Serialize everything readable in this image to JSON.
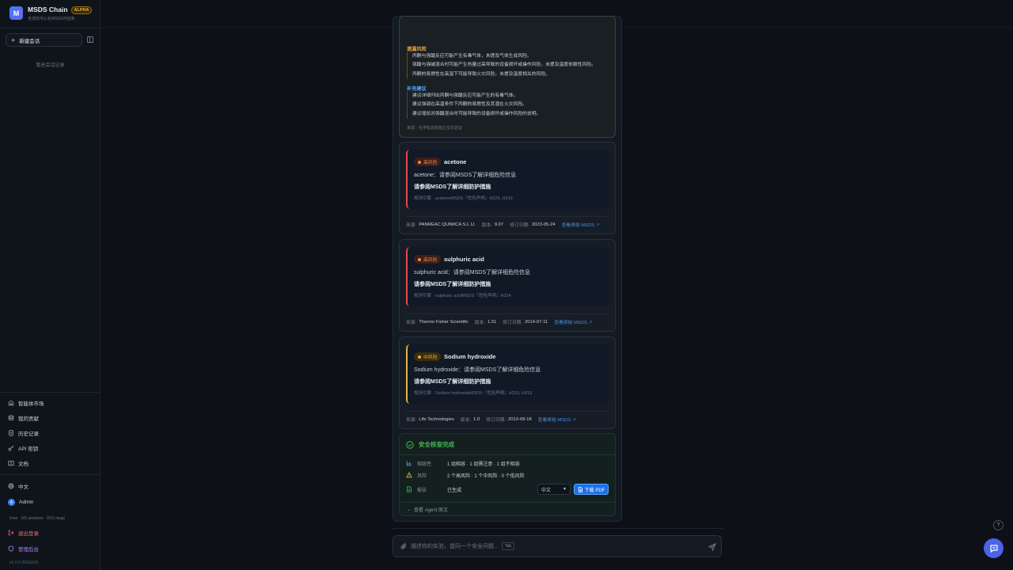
{
  "app": {
    "title": "MSDS Chain",
    "badge": "ALPHA",
    "subtitle": "全球去中心化MSDS可信库",
    "logo_letter": "M"
  },
  "sidebar": {
    "new_chat_label": "新建会话",
    "no_sessions": "暂无会话记录",
    "nav": [
      {
        "label": "智能体市场",
        "icon": "store-icon"
      },
      {
        "label": "我的贡献",
        "icon": "database-icon"
      },
      {
        "label": "历史记录",
        "icon": "file-history-icon"
      },
      {
        "label": "API 密钥",
        "icon": "key-icon"
      },
      {
        "label": "文档",
        "icon": "book-icon"
      }
    ],
    "language": "中文",
    "user_initial": "A",
    "user_name": "Admin",
    "plan": "Free · 0/3 sessions · 0/15 msgs",
    "logout": "退出登录",
    "admin": "管理后台",
    "version": "v0.2.0 (f90a1b0)"
  },
  "summary": {
    "missed_title": "遗漏风险",
    "missed": [
      "丙酮与强酸反应可能产生有毒气体，未提及气体生成风险。",
      "强酸与强碱混合时可能产生热量过高导致的设备损坏或操作风险，未提及温度依赖性风险。",
      "丙酮的易燃性在高温下可能导致火灾风险，未提及温度相关的风险。"
    ],
    "suggest_title": "补充建议",
    "suggest": [
      "建议详细列出丙酮与强酸反应可能产生的有毒气体。",
      "建议强调在高温条件下丙酮的易燃性及其潜在火灾风险。",
      "建议增加对强酸混合时可能导致的设备损坏或操作风险的说明。"
    ],
    "source": "来源：化学知识库独立交叉验证"
  },
  "chemicals": [
    {
      "risk": "高风险",
      "level": "high",
      "name": "acetone",
      "desc": "acetone：请参阅MSDS了解详细危险信息",
      "protect": "请参阅MSDS了解详细防护措施",
      "rule": "规则引擎 · acetoneMSDS『危险声明』H226, H319",
      "meta": {
        "source_k": "来源:",
        "source_v": "PANREAC QUIMICA S.L.U.",
        "version_k": "版本:",
        "version_v": "9.07",
        "date_k": "修订日期:",
        "date_v": "2023-05-24",
        "link": "查看原始 MSDS ↗"
      }
    },
    {
      "risk": "高风险",
      "level": "high",
      "name": "sulphuric acid",
      "desc": "sulphuric acid：请参阅MSDS了解详细危险信息",
      "protect": "请参阅MSDS了解详细防护措施",
      "rule": "规则引擎 · sulphuric acidMSDS『危险声明』H314",
      "meta": {
        "source_k": "来源:",
        "source_v": "Thermo Fisher Scientific",
        "version_k": "版本:",
        "version_v": "1.01",
        "date_k": "修订日期:",
        "date_v": "2014-07-11",
        "link": "查看原始 MSDS ↗"
      }
    },
    {
      "risk": "中风险",
      "level": "mid",
      "name": "Sodium hydroxide",
      "desc": "Sodium hydroxide：请参阅MSDS了解详细危险信息",
      "protect": "请参阅MSDS了解详细防护措施",
      "rule": "规则引擎 · Sodium hydroxideMSDS『危险声明』H315, H319",
      "meta": {
        "source_k": "来源:",
        "source_v": "Life Technologies",
        "version_k": "版本:",
        "version_v": "1.0",
        "date_k": "修订日期:",
        "date_v": "2013-09-18",
        "link": "查看原始 MSDS ↗"
      }
    }
  ],
  "result": {
    "title": "安全核查完成",
    "compat_k": "相容性",
    "compat_v": "1 组相容 · 1 组需注意 · 1 组不相容",
    "risk_k": "风险",
    "risk_v": "2 个高风险 · 1 个中风险 · 0 个低风险",
    "report_k": "报告",
    "report_v": "已生成",
    "lang_value": "中文",
    "pdf_label": "下载 PDF",
    "agent_raw": "查看 Agent 原文"
  },
  "input": {
    "placeholder": "描述你的实验，提问一个安全问题...",
    "tab_hint": "Tab"
  },
  "help": "?",
  "colors": {
    "accent": "#1f6feb",
    "high_risk": "#e5484d",
    "mid_risk": "#e3b341",
    "success": "#3fb950"
  }
}
